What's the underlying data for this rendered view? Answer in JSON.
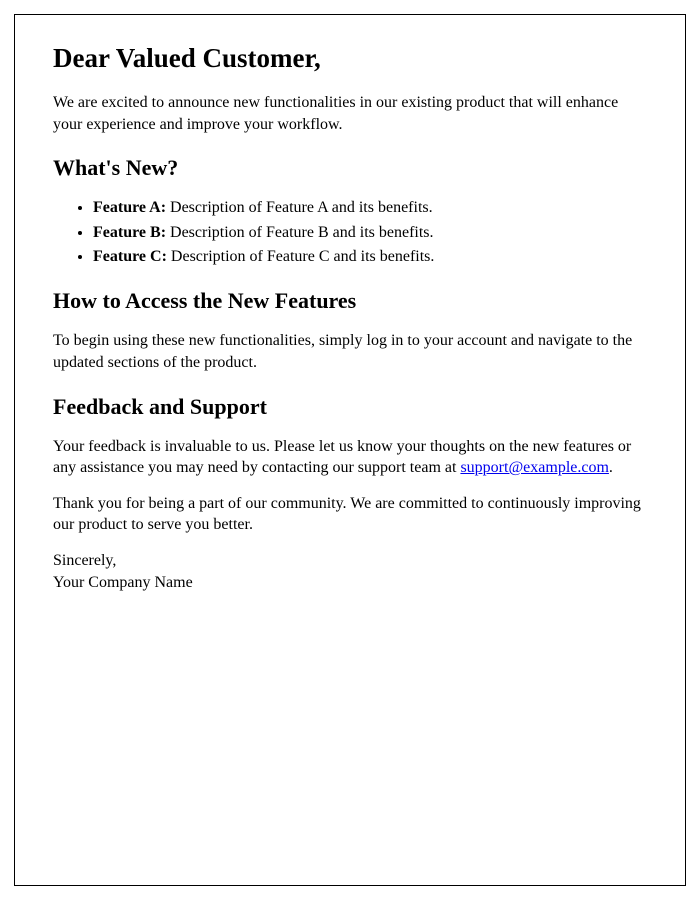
{
  "greeting": "Dear Valued Customer,",
  "intro": "We are excited to announce new functionalities in our existing product that will enhance your experience and improve your workflow.",
  "sections": {
    "whats_new": {
      "heading": "What's New?",
      "features": [
        {
          "name": "Feature A:",
          "desc": " Description of Feature A and its benefits."
        },
        {
          "name": "Feature B:",
          "desc": " Description of Feature B and its benefits."
        },
        {
          "name": "Feature C:",
          "desc": " Description of Feature C and its benefits."
        }
      ]
    },
    "access": {
      "heading": "How to Access the New Features",
      "body": "To begin using these new functionalities, simply log in to your account and navigate to the updated sections of the product."
    },
    "feedback": {
      "heading": "Feedback and Support",
      "body_prefix": "Your feedback is invaluable to us. Please let us know your thoughts on the new features or any assistance you may need by contacting our support team at ",
      "email": "support@example.com",
      "body_suffix": "."
    }
  },
  "thanks": "Thank you for being a part of our community. We are committed to continuously improving our product to serve you better.",
  "closing": {
    "signoff": "Sincerely,",
    "company": "Your Company Name"
  }
}
